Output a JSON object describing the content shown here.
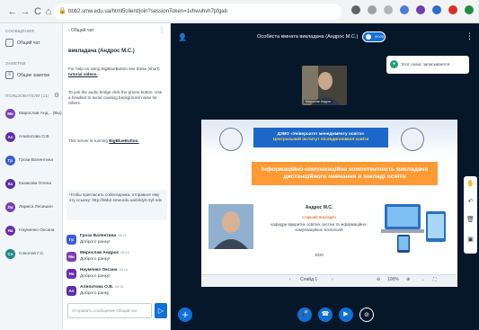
{
  "browser": {
    "back": "←",
    "forward": "→",
    "reload": "C",
    "home": "⌂",
    "url": "bbb2.smw.edu.ua/html5client/join?sessionToken=1vhwuhvh7pfgab",
    "colors": {
      "toolbar": "#f1f3f4"
    }
  },
  "sidebar": {
    "messages_label": "СООБЩЕНИЯ",
    "public_chat": "Общий чат",
    "notes_label": "ЗАМЕТКИ",
    "shared_notes": "Общие заметки",
    "users_label": "ПОЛЬЗОВАТЕЛИ (11)",
    "users": [
      {
        "initials": "Ми",
        "name": "Мирослав Анд... (Вы)",
        "color": "#7b3fb4"
      },
      {
        "initials": "Ал",
        "name": "Алипатова О.В.",
        "color": "#5b2fa8"
      },
      {
        "initials": "Гр",
        "name": "Гроза Валентина",
        "color": "#3b5bdb"
      },
      {
        "initials": "Ка",
        "name": "Казакова Олена",
        "color": "#5b2fa8"
      },
      {
        "initials": "Ла",
        "name": "Лариса Лесишин",
        "color": "#7b3fb4"
      },
      {
        "initials": "На",
        "name": "Науменко Оксана",
        "color": "#6a2fae"
      },
      {
        "initials": "Со",
        "name": "Соколов Г.С.",
        "color": "#1d8a8a"
      }
    ]
  },
  "chat": {
    "header": "‹  Общий чат",
    "welcome_title": "викладача (Андрос М.С.)",
    "help_text_1": "For help on using BigBlueButton see these (short)",
    "help_link": "tutorial videos.",
    "help_text_2": "To join the audio bridge click the phone button. Use a headset to avoid causing background noise for others.",
    "running_text": "This server is running",
    "running_link": "BigBlueButton.",
    "invite_text": "Чтобы пригласить собеседника, отправьте ему эту ссылку: http://bbb2.smw.edu.ua/b/ldyh-3yf-ndx",
    "messages": [
      {
        "initials": "Гр",
        "name": "Гроза Валентина",
        "time": "08:15",
        "text": "Доброго ранку!",
        "color": "#3b5bdb"
      },
      {
        "initials": "Ми",
        "name": "Мирослав Андрос",
        "time": "08:15",
        "text": "Доброго ранку!",
        "color": "#7b3fb4"
      },
      {
        "initials": "На",
        "name": "Науменко Оксана",
        "time": "08:16",
        "text": "Доброго ранку!",
        "color": "#6a2fae"
      },
      {
        "initials": "Ал",
        "name": "Алипатова О.В.",
        "time": "08:16",
        "text": "Доброго ранку",
        "color": "#5b2fa8"
      }
    ],
    "input_placeholder": "Отправить сообщение Общий чат",
    "send_icon": "▷"
  },
  "main": {
    "meeting_title": "Особиста кімната викладача (Андрос М.С.)",
    "rec_label": "00:00",
    "toast_text": "Этот сеанс записывается",
    "webcam_label": "Мирослав Андрос",
    "colors": {
      "background": "#06172a",
      "accent": "#0f70d7"
    }
  },
  "slide": {
    "university": "ДЗВО «Університет менеджменту освіти»",
    "institute": "Центральний інститут післядипломної освіти",
    "title": "Інформаційно-комунікаційна компетентність викладача дистанційного навчання в закладі освіти",
    "author": "Андрос М.С.",
    "role": "старший викладач",
    "department": "кафедри відкритих освітніх систем та інформаційно-комунікаційних технологій",
    "year": "2020",
    "slide_nav": "Слайд 1",
    "zoom": "100%",
    "colors": {
      "orange": "#ff9a34",
      "blue": "#1c67c9"
    }
  }
}
